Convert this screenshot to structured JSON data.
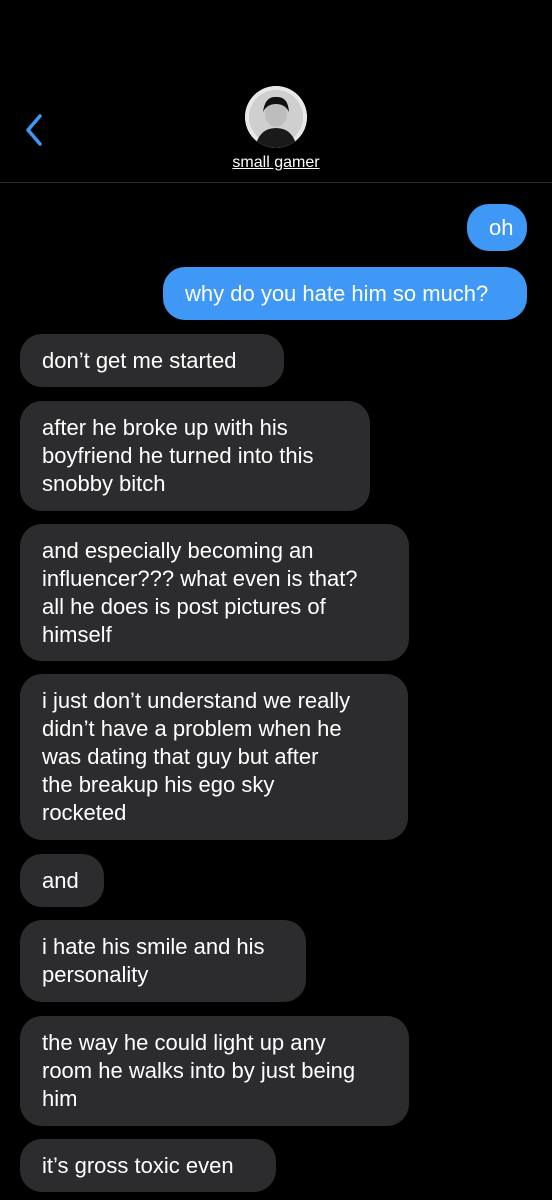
{
  "header": {
    "contact_name": "small gamer"
  },
  "messages": [
    {
      "direction": "out",
      "text": "oh"
    },
    {
      "direction": "out",
      "text": "why do you hate him so much?"
    },
    {
      "direction": "in",
      "text": "don’t get me started"
    },
    {
      "direction": "in",
      "text": "after he broke up with his\nboyfriend he turned into this\nsnobby bitch"
    },
    {
      "direction": "in",
      "text": "and especially becoming an\ninfluencer??? what even is that?\nall he does is post pictures of\nhimself"
    },
    {
      "direction": "in",
      "text": "i just don’t understand we really\ndidn’t have a problem when he\nwas dating that guy but after\nthe breakup his ego sky\nrocketed"
    },
    {
      "direction": "in",
      "text": "and"
    },
    {
      "direction": "in",
      "text": "i hate his smile and his\npersonality"
    },
    {
      "direction": "in",
      "text": "the way he could light up any\nroom he walks into by just being\nhim"
    },
    {
      "direction": "in",
      "text": "it’s gross toxic even"
    }
  ],
  "colors": {
    "outgoing_bubble": "#3f97f6",
    "incoming_bubble": "#2c2c2e",
    "accent": "#3f97f6",
    "background": "#000000"
  },
  "icons": {
    "back": "chevron-left-icon",
    "avatar": "contact-avatar"
  }
}
